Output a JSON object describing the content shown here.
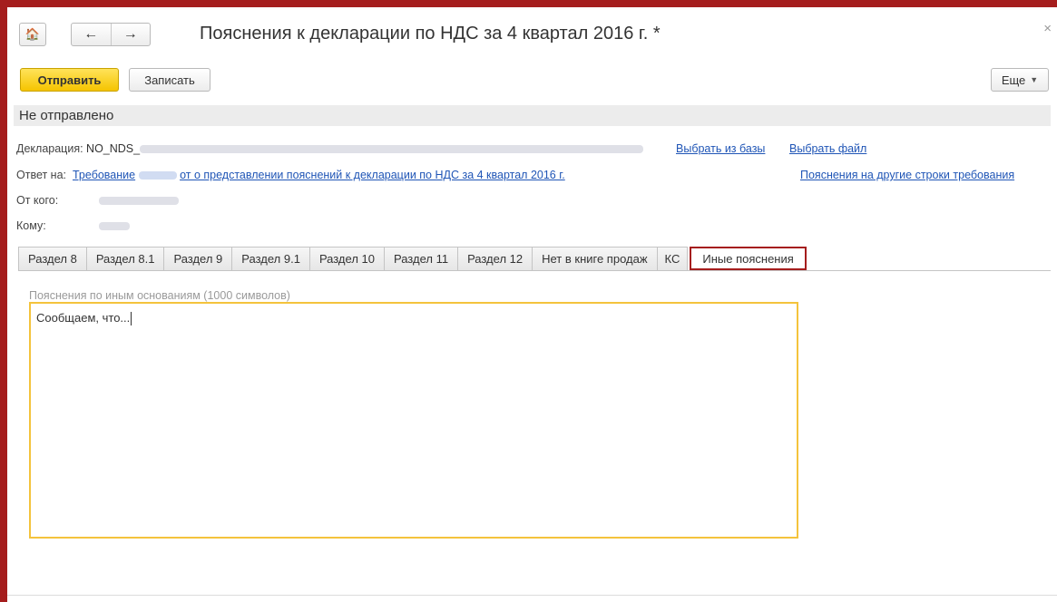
{
  "window": {
    "title": "Пояснения к декларации по НДС за 4 квартал 2016 г. *",
    "close_glyph": "×",
    "home_glyph": "🏠",
    "back_glyph": "←",
    "forward_glyph": "→"
  },
  "toolbar": {
    "send_label": "Отправить",
    "save_label": "Записать",
    "more_label": "Еще",
    "more_arrow": "▼"
  },
  "status": "Не отправлено",
  "declaration": {
    "label": "Декларация:",
    "value_prefix": "NO_NDS_",
    "select_from_base": "Выбрать из базы",
    "select_file": "Выбрать файл"
  },
  "reply_to": {
    "label": "Ответ на:",
    "link_part1": "Требование",
    "link_part2": "от  о представлении пояснений к декларации по НДС за 4 квартал 2016 г.",
    "other_lines_link": "Пояснения на другие строки требования"
  },
  "from": {
    "label": "От кого:"
  },
  "to": {
    "label": "Кому:"
  },
  "tabs": [
    {
      "label": "Раздел 8"
    },
    {
      "label": "Раздел 8.1"
    },
    {
      "label": "Раздел 9"
    },
    {
      "label": "Раздел 9.1"
    },
    {
      "label": "Раздел 10"
    },
    {
      "label": "Раздел 11"
    },
    {
      "label": "Раздел 12"
    },
    {
      "label": "Нет в книге продаж"
    },
    {
      "label": "КС"
    },
    {
      "label": "Иные пояснения"
    }
  ],
  "other_explanations": {
    "caption": "Пояснения по иным основаниям (1000 символов)",
    "text": "Сообщаем, что..."
  },
  "colors": {
    "frame_highlight": "#a51d1d",
    "send_button": "#f5c400",
    "link": "#1f55b6",
    "textarea_border": "#f4c33c"
  }
}
